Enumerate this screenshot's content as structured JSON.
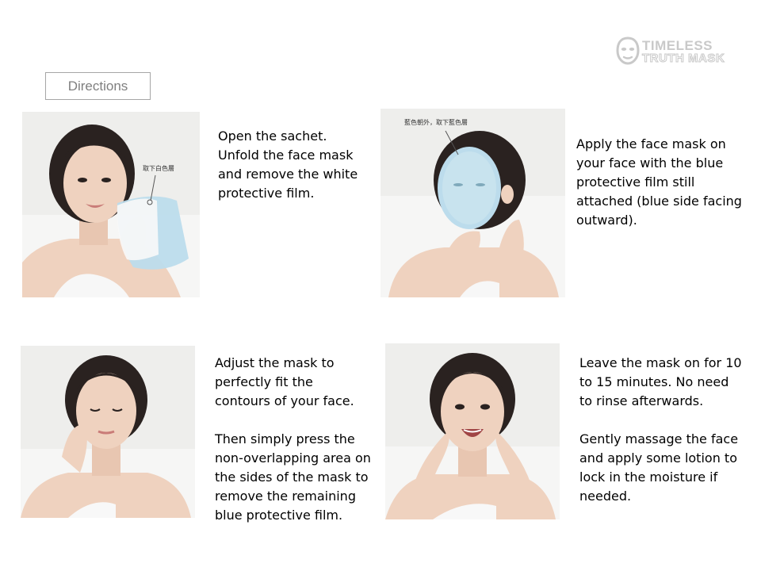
{
  "logo": {
    "line1": "TIMELESS",
    "line2": "TRUTH MASK",
    "icon": "face-mask-icon",
    "color": "#c9c9c9"
  },
  "header": {
    "directions_label": "Directions"
  },
  "steps": [
    {
      "paragraphs": [
        "Open the sachet.\nUnfold the face mask\nand remove the white\nprotective film."
      ],
      "photo_caption": "取下白色層"
    },
    {
      "paragraphs": [
        "Apply the face mask on\nyour face with the blue\nprotective film still\nattached (blue side facing\noutward)."
      ],
      "photo_caption": "藍色朝外，取下藍色層"
    },
    {
      "paragraphs": [
        "Adjust the mask to\nperfectly fit the\ncontours of your face.",
        "Then simply press the\nnon-overlapping area on\nthe sides of the mask to\nremove the remaining\nblue protective film."
      ]
    },
    {
      "paragraphs": [
        "Leave the mask on for 10\nto 15 minutes. No need\nto rinse afterwards.",
        "Gently massage the face\nand apply some lotion to\nlock in the moisture if\nneeded."
      ]
    }
  ],
  "colors": {
    "mask_blue": "#bcdcec",
    "skin": "#efd2bf",
    "hair": "#2a2220",
    "photo_bg": "#eeeeec"
  }
}
